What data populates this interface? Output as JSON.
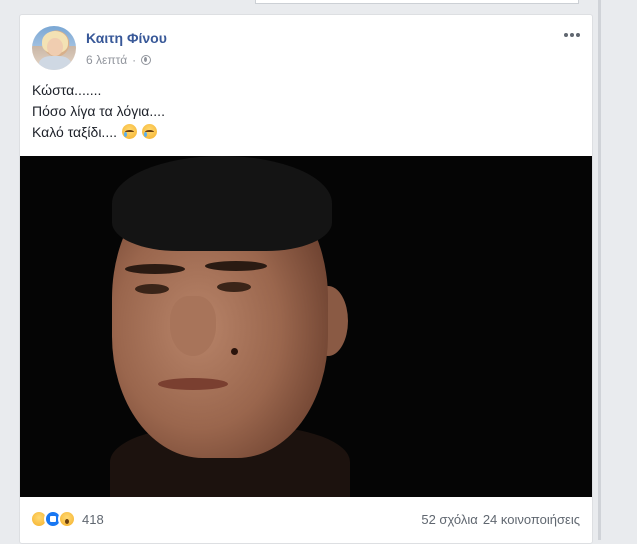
{
  "post": {
    "author": "Καιτη Φίνου",
    "time": "6 λεπτά",
    "text": {
      "line1": "Κώστα.......",
      "line2": "Πόσο λίγα τα λόγια....",
      "line3": "Καλό ταξίδι...."
    }
  },
  "footer": {
    "reaction_count": "418",
    "comments": "52 σχόλια",
    "shares": "24 κοινοποιήσεις"
  },
  "icons": {
    "privacy": "globe-icon",
    "menu": "more-icon",
    "reactions": [
      "sad-icon",
      "like-icon",
      "wow-icon"
    ]
  },
  "colors": {
    "author_link": "#385898",
    "page_bg": "#e9ebee",
    "text": "#1d2129",
    "meta": "#90949c"
  }
}
